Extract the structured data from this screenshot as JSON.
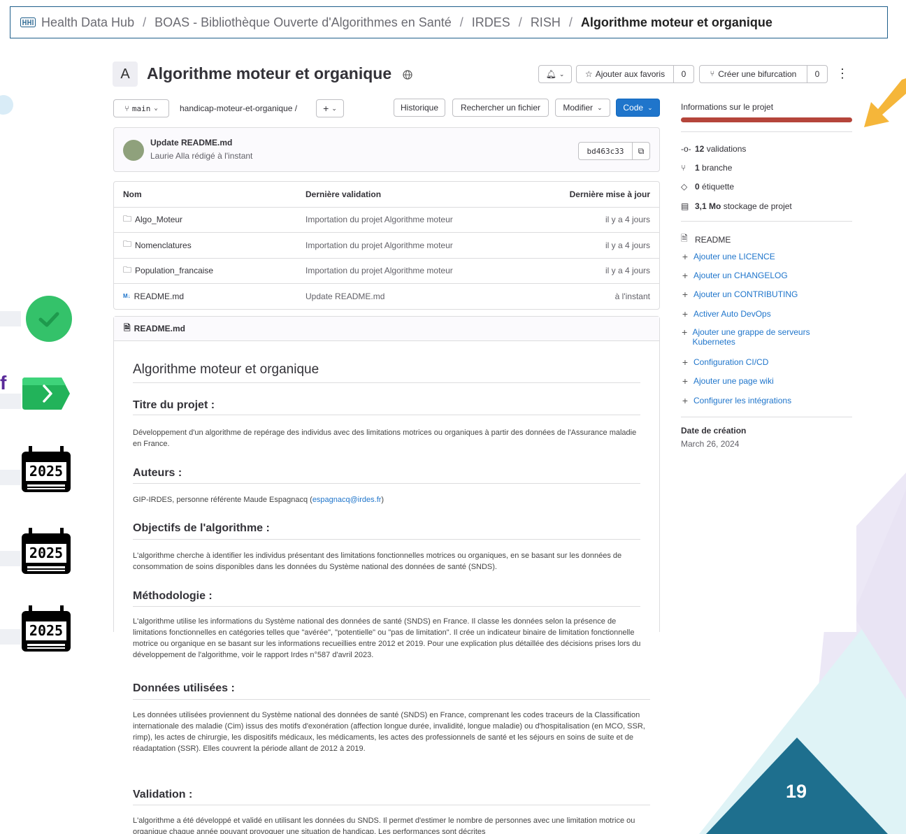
{
  "breadcrumb": {
    "items": [
      "Health Data Hub",
      "BOAS - Bibliothèque Ouverte d'Algorithmes en Santé",
      "IRDES",
      "RISH"
    ],
    "current": "Algorithme moteur et organique"
  },
  "project": {
    "avatar_letter": "A",
    "title": "Algorithme moteur et organique",
    "favorite_label": "Ajouter aux favoris",
    "favorite_count": "0",
    "fork_label": "Créer une bifurcation",
    "fork_count": "0"
  },
  "toolbar": {
    "branch": "main",
    "path": "handicap-moteur-et-organique",
    "path_sep": "/",
    "history": "Historique",
    "find_file": "Rechercher un fichier",
    "edit": "Modifier",
    "code": "Code"
  },
  "commit": {
    "message": "Update README.md",
    "author_line": "Laurie Alla rédigé à l'instant",
    "sha": "bd463c33"
  },
  "files": {
    "headers": [
      "Nom",
      "Dernière validation",
      "Dernière mise à jour"
    ],
    "rows": [
      {
        "name": "Algo_Moteur",
        "commit": "Importation du projet Algorithme moteur",
        "updated": "il y a 4 jours",
        "icon": "folder-icon"
      },
      {
        "name": "Nomenclatures",
        "commit": "Importation du projet Algorithme moteur",
        "updated": "il y a 4 jours",
        "icon": "folder-icon"
      },
      {
        "name": "Population_francaise",
        "commit": "Importation du projet Algorithme moteur",
        "updated": "il y a 4 jours",
        "icon": "folder-icon"
      },
      {
        "name": "README.md",
        "commit": "Update README.md",
        "updated": "à l'instant",
        "icon": "markdown-icon"
      }
    ]
  },
  "readme": {
    "file_label": "README.md",
    "title": "Algorithme moteur et organique",
    "h_titre": "Titre du projet :",
    "p_titre": "Développement d'un algorithme de repérage des individus avec des limitations motrices ou organiques à partir des données de l'Assurance maladie en France.",
    "h_auteurs": "Auteurs :",
    "p_auteurs_prefix": "GIP-IRDES, personne référente Maude Espagnacq (",
    "p_auteurs_email": "espagnacq@irdes.fr",
    "p_auteurs_suffix": ")",
    "h_objectifs": "Objectifs de l'algorithme :",
    "p_objectifs": "L'algorithme cherche à identifier les individus présentant des limitations fonctionnelles motrices ou organiques, en se basant sur les données de consommation de soins disponibles dans les données du Système national des données de santé (SNDS).",
    "h_methodo": "Méthodologie :",
    "p_methodo": "L'algorithme utilise les informations du Système national des données de santé (SNDS) en France. Il classe les données selon la présence de limitations fonctionnelles en catégories telles que \"avérée\", \"potentielle\" ou \"pas de limitation\". Il crée un indicateur binaire de limitation fonctionnelle motrice ou organique en se basant sur les informations recueillies entre 2012 et 2019. Pour une explication plus détaillée des décisions prises lors du développement de l'algorithme, voir le rapport Irdes n°587 d'avril 2023.",
    "h_donnees": "Données utilisées :",
    "p_donnees": "Les données utilisées proviennent du Système national des données de santé (SNDS) en France, comprenant les codes traceurs de la Classification internationale des maladie (Cim) issus des motifs d'exonération (affection longue durée, invalidité, longue maladie) ou d'hospitalisation (en MCO, SSR, rimp), les actes de chirurgie, les dispositifs médicaux, les médicaments, les actes des professionnels de santé et les séjours en soins de suite et de réadaptation (SSR). Elles couvrent la période allant de 2012 à 2019.",
    "h_validation": "Validation :",
    "p_validation": "L'algorithme a été développé et validé en utilisant les données du SNDS. Il permet d'estimer le nombre de personnes avec une limitation motrice ou organique chaque année pouvant provoquer une situation de handicap. Les performances sont décrites"
  },
  "sidebar": {
    "title": "Informations sur le projet",
    "stats": [
      {
        "bold": "12",
        "text": "validations",
        "icon": "commit-icon"
      },
      {
        "bold": "1",
        "text": "branche",
        "icon": "branch-icon"
      },
      {
        "bold": "0",
        "text": "étiquette",
        "icon": "tag-icon"
      },
      {
        "bold": "3,1 Mo",
        "text": "stockage de projet",
        "icon": "storage-icon"
      }
    ],
    "readme_label": "README",
    "links": [
      "Ajouter une LICENCE",
      "Ajouter un CHANGELOG",
      "Ajouter un CONTRIBUTING",
      "Activer Auto DevOps",
      "Ajouter une grappe de serveurs Kubernetes",
      "Configuration CI/CD",
      "Ajouter une page wiki",
      "Configurer les intégrations"
    ],
    "created_label": "Date de création",
    "created_date": "March 26, 2024"
  },
  "slide": {
    "page_number": "19",
    "letter": "f",
    "calendar_year": "2025",
    "colors": {
      "accent_red": "#b5453b",
      "arrow": "#f5b63a",
      "teal": "#1e6f8e",
      "green": "#34c26a"
    }
  }
}
